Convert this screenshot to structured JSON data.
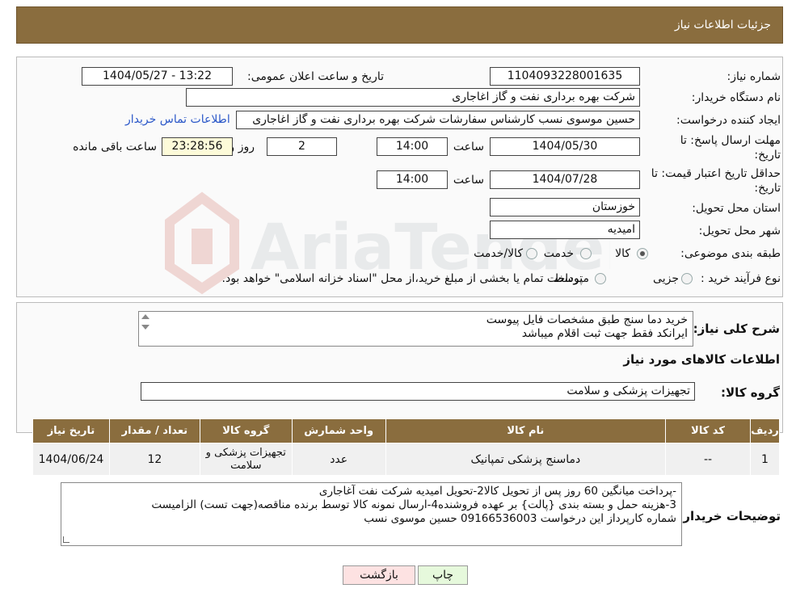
{
  "header": {
    "title": "جزئیات اطلاعات نیاز"
  },
  "info": {
    "need_number_label": "شماره نیاز:",
    "need_number": "1104093228001635",
    "announce_label": "تاریخ و ساعت اعلان عمومی:",
    "announce_value": "1404/05/27 - 13:22",
    "buyer_org_label": "نام دستگاه خریدار:",
    "buyer_org": "شرکت بهره برداری نفت و گاز اغاجاری",
    "creator_label": "ایجاد کننده درخواست:",
    "creator": "حسین موسوی نسب کارشناس سفارشات شرکت بهره برداری نفت و گاز اغاجاری",
    "contact_link": "اطلاعات تماس خریدار",
    "deadline_label_1": "مهلت ارسال پاسخ: تا",
    "deadline_label_2": "تاریخ:",
    "deadline_date": "1404/05/30",
    "time_label": "ساعت",
    "deadline_time": "14:00",
    "days_value": "2",
    "days_label": "روز و",
    "remaining_value": "23:28:56",
    "remaining_label": "ساعت باقی مانده",
    "validity_label_1": "حداقل تاریخ اعتبار قیمت: تا",
    "validity_label_2": "تاریخ:",
    "validity_date": "1404/07/28",
    "validity_time": "14:00",
    "province_label": "استان محل تحویل:",
    "province": "خوزستان",
    "city_label": "شهر محل تحویل:",
    "city": "امیدیه",
    "category_label": "طبقه بندی موضوعی:",
    "category_options": [
      "کالا",
      "خدمت",
      "کالا/خدمت"
    ],
    "category_selected": "کالا",
    "purchase_type_label": "نوع فرآیند خرید :",
    "purchase_options": [
      "جزیی",
      "متوسط"
    ],
    "purchase_note": "پرداخت تمام یا بخشی از مبلغ خرید،از محل \"اسناد خزانه اسلامی\" خواهد بود."
  },
  "description": {
    "label": "شرح کلی نیاز:",
    "line1": "خرید دما سنج طبق مشخصات فایل پیوست",
    "line2": "ایرانکد فقط جهت ثبت اقلام میباشد"
  },
  "goods": {
    "section_title": "اطلاعات کالاهای مورد نیاز",
    "group_label": "گروه کالا:",
    "group_value": "تجهیزات پزشکی و سلامت",
    "columns": [
      "ردیف",
      "کد کالا",
      "نام کالا",
      "واحد شمارش",
      "گروه کالا",
      "تعداد / مقدار",
      "تاریخ نیاز"
    ],
    "rows": [
      [
        "1",
        "--",
        "دماسنج پزشکی تمپانیک",
        "عدد",
        "تجهیزات پزشکی و سلامت",
        "12",
        "1404/06/24"
      ]
    ]
  },
  "buyer_notes": {
    "label": "توضیحات خریدار:",
    "line1": "-پرداخت میانگین 60 روز پس از تحویل کالا2-تحویل امیدیه شرکت نفت آغاجاری",
    "line2": "3-هزینه حمل  و بسته بندی {پالت} بر عهده فروشنده4-ارسال نمونه کالا توسط برنده مناقصه(جهت تست) الزامیست",
    "line3": "شماره کارپرداز این درخواست 09166536003 حسین موسوی نسب"
  },
  "buttons": {
    "print": "چاپ",
    "back": "بازگشت"
  },
  "watermark": {
    "text": "AriaTender.neT"
  },
  "colors": {
    "header": "#8a6d3e",
    "highlight": "#fdfbd9",
    "link": "#2a57c8",
    "print_btn": "#e6f9dc",
    "back_btn": "#fde2e2"
  }
}
